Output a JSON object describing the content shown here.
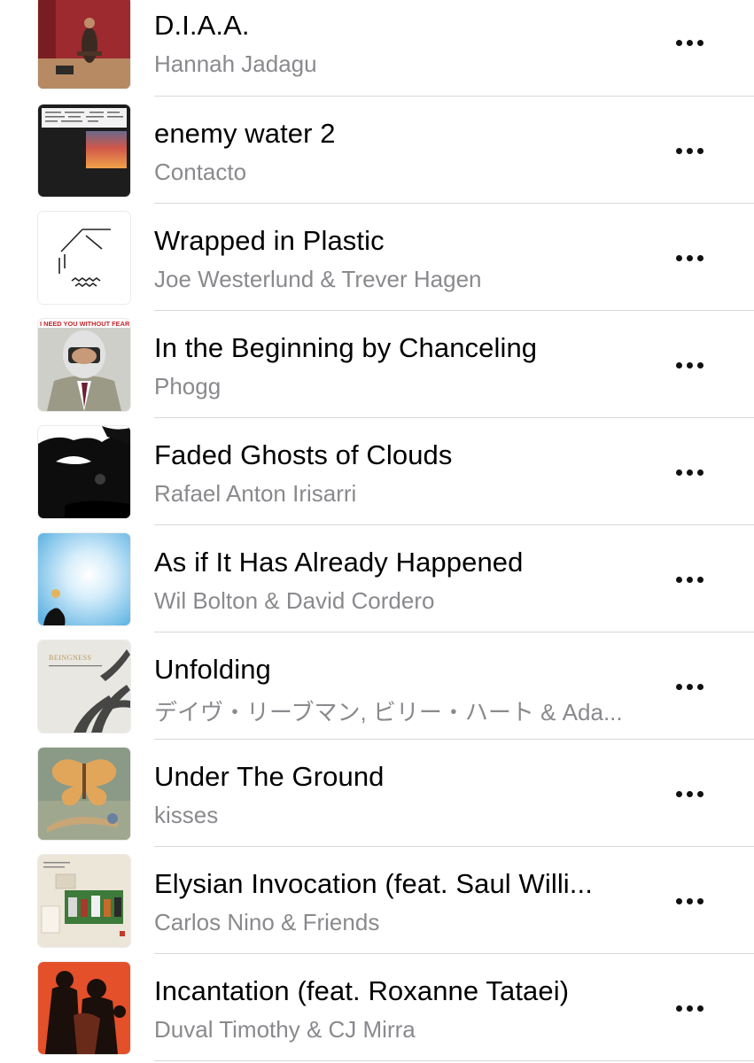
{
  "tracks": [
    {
      "title": "D.I.A.A.",
      "artist": "Hannah Jadagu",
      "art_icon": "album-art-red-room"
    },
    {
      "title": "enemy water 2",
      "artist": "Contacto",
      "art_icon": "album-art-dark-sunset"
    },
    {
      "title": "Wrapped in Plastic",
      "artist": "Joe Westerlund & Trever Hagen",
      "art_icon": "album-art-line-drawing"
    },
    {
      "title": "In the Beginning by Chanceling",
      "artist": "Phogg",
      "art_icon": "album-art-helmet-man",
      "art_text": "I NEED YOU WITHOUT FEAR"
    },
    {
      "title": "Faded Ghosts of Clouds",
      "artist": "Rafael Anton Irisarri",
      "art_icon": "album-art-black-clouds"
    },
    {
      "title": "As if It Has Already Happened",
      "artist": "Wil Bolton & David Cordero",
      "art_icon": "album-art-blue-sky"
    },
    {
      "title": "Unfolding",
      "artist": "デイヴ・リーブマン, ビリー・ハート & Ada...",
      "art_icon": "album-art-beingness",
      "art_text": "BEINGNESS"
    },
    {
      "title": "Under The Ground",
      "artist": "kisses",
      "art_icon": "album-art-butterfly-painting"
    },
    {
      "title": "Elysian Invocation (feat. Saul Willi...",
      "artist": "Carlos Nino & Friends",
      "art_icon": "album-art-collage"
    },
    {
      "title": "Incantation (feat. Roxanne Tataei)",
      "artist": "Duval Timothy & CJ Mirra",
      "art_icon": "album-art-orange-silhouettes"
    }
  ],
  "more_icon": "ellipsis-icon",
  "colors": {
    "title": "#000000",
    "artist": "#8a8a8e",
    "divider": "#d9d9dc",
    "dots": "#111111"
  }
}
